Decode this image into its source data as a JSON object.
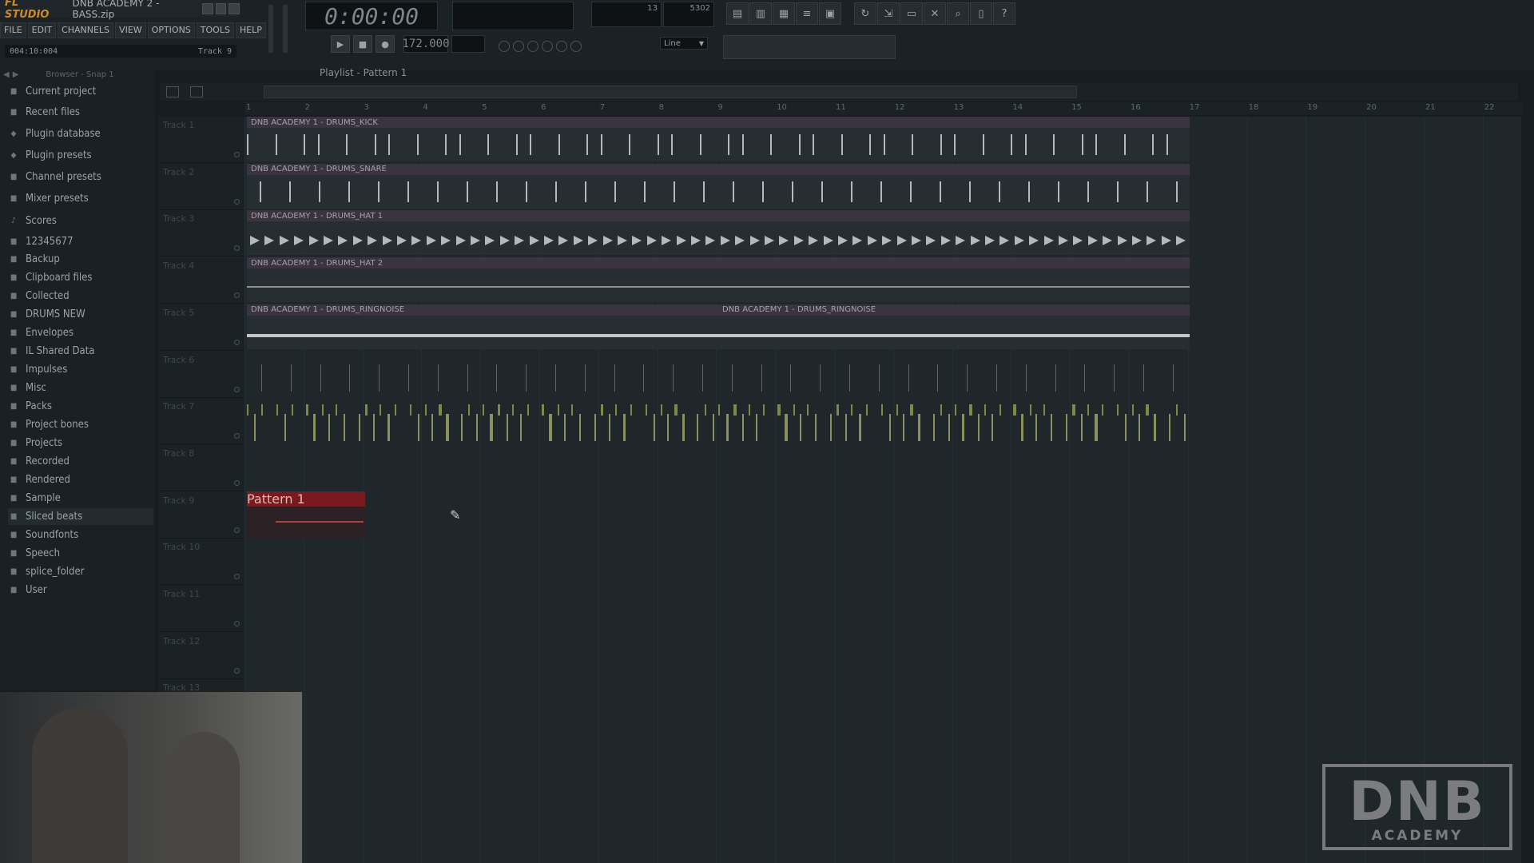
{
  "app": {
    "logo": "FL STUDIO",
    "project_name": "DNB ACADEMY 2 - BASS.zip"
  },
  "menu": [
    "FILE",
    "EDIT",
    "CHANNELS",
    "VIEW",
    "OPTIONS",
    "TOOLS",
    "HELP"
  ],
  "hint_bar": {
    "position": "004:10:004",
    "track": "Track 9"
  },
  "transport": {
    "time": "0:00:00",
    "tempo": "172.000",
    "cpu_value": "13",
    "mem_value": "5302",
    "snap_mode": "Line"
  },
  "browser": {
    "header": "Browser - Snap 1",
    "items": [
      {
        "label": "Current project",
        "icon": "project-icon"
      },
      {
        "label": "Recent files",
        "icon": "folder-icon"
      },
      {
        "label": "Plugin database",
        "icon": "plug-icon"
      },
      {
        "label": "Plugin presets",
        "icon": "plug-icon"
      },
      {
        "label": "Channel presets",
        "icon": "channel-icon"
      },
      {
        "label": "Mixer presets",
        "icon": "mixer-icon"
      },
      {
        "label": "Scores",
        "icon": "note-icon"
      },
      {
        "label": "12345677",
        "icon": "folder-icon"
      },
      {
        "label": "Backup",
        "icon": "folder-icon"
      },
      {
        "label": "Clipboard files",
        "icon": "folder-icon"
      },
      {
        "label": "Collected",
        "icon": "folder-icon"
      },
      {
        "label": "DRUMS NEW",
        "icon": "folder-icon"
      },
      {
        "label": "Envelopes",
        "icon": "folder-icon"
      },
      {
        "label": "IL Shared Data",
        "icon": "folder-icon"
      },
      {
        "label": "Impulses",
        "icon": "folder-icon"
      },
      {
        "label": "Misc",
        "icon": "folder-icon"
      },
      {
        "label": "Packs",
        "icon": "folder-icon"
      },
      {
        "label": "Project bones",
        "icon": "folder-icon"
      },
      {
        "label": "Projects",
        "icon": "folder-icon"
      },
      {
        "label": "Recorded",
        "icon": "folder-icon"
      },
      {
        "label": "Rendered",
        "icon": "folder-icon"
      },
      {
        "label": "Sample",
        "icon": "folder-icon"
      },
      {
        "label": "Sliced beats",
        "icon": "folder-icon"
      },
      {
        "label": "Soundfonts",
        "icon": "folder-icon"
      },
      {
        "label": "Speech",
        "icon": "folder-icon"
      },
      {
        "label": "splice_folder",
        "icon": "folder-icon"
      },
      {
        "label": "User",
        "icon": "folder-icon"
      }
    ]
  },
  "playlist": {
    "title": "Playlist - Pattern 1",
    "bars": [
      "1",
      "2",
      "3",
      "4",
      "5",
      "6",
      "7",
      "8",
      "9",
      "10",
      "11",
      "12",
      "13",
      "14",
      "15",
      "16",
      "17",
      "18",
      "19",
      "20",
      "21",
      "22"
    ],
    "tracks": [
      "Track 1",
      "Track 2",
      "Track 3",
      "Track 4",
      "Track 5",
      "Track 6",
      "Track 7",
      "Track 8",
      "Track 9",
      "Track 10",
      "Track 11",
      "Track 12",
      "Track 13"
    ],
    "clips": [
      {
        "label": "DNB ACADEMY 1 - DRUMS_KICK"
      },
      {
        "label": "DNB ACADEMY 1 - DRUMS_SNARE"
      },
      {
        "label": "DNB ACADEMY 1 - DRUMS_HAT 1"
      },
      {
        "label": "DNB ACADEMY 1 - DRUMS_HAT 2"
      },
      {
        "label": "DNB ACADEMY 1 - DRUMS_RINGNOISE"
      },
      {
        "label": "DNB ACADEMY 1 - DRUMS_RINGNOISE"
      }
    ],
    "pattern_clip": "Pattern 1"
  },
  "watermark": {
    "big": "DNB",
    "small": "ACADEMY"
  }
}
